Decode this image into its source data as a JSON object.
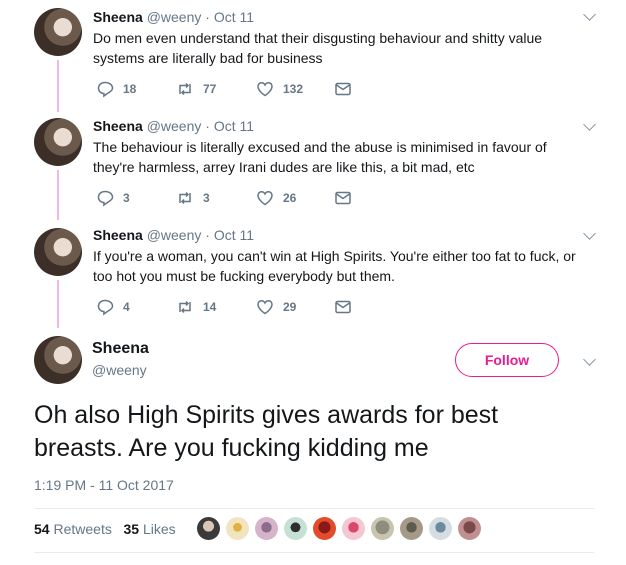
{
  "colors": {
    "accent": "#e81c8f",
    "thread_line": "#f4b8e6",
    "muted": "#657786"
  },
  "replies": [
    {
      "name": "Sheena",
      "handle": "@weeny",
      "date": "Oct 11",
      "lines": [
        "Do men even understand that their disgusting behaviour and shitty value",
        "systems are literally bad for business"
      ],
      "counts": {
        "replies": "18",
        "retweets": "77",
        "likes": "132"
      }
    },
    {
      "name": "Sheena",
      "handle": "@weeny",
      "date": "Oct 11",
      "lines": [
        "The behaviour is literally excused and the abuse is minimised in favour of",
        "they're harmless, arrey Irani dudes are like this, a bit mad, etc"
      ],
      "counts": {
        "replies": "3",
        "retweets": "3",
        "likes": "26"
      }
    },
    {
      "name": "Sheena",
      "handle": "@weeny",
      "date": "Oct 11",
      "lines": [
        "If you're a woman, you can't win at High Spirits. You're either too fat to fuck, or",
        "too hot you must be fucking everybody but them."
      ],
      "counts": {
        "replies": "4",
        "retweets": "14",
        "likes": "29"
      }
    }
  ],
  "main": {
    "name": "Sheena",
    "handle": "@weeny",
    "follow_label": "Follow",
    "text_line1": "Oh also High Spirits gives awards for best",
    "text_line2": "breasts. Are you fucking kidding me",
    "timestamp": "1:19 PM - 11 Oct 2017",
    "retweets_count": "54",
    "retweets_label": "Retweets",
    "likes_count": "35",
    "likes_label": "Likes"
  },
  "icons": {
    "reply": "reply-icon",
    "retweet": "retweet-icon",
    "like": "heart-icon",
    "dm": "envelope-icon",
    "menu": "chevron-down-icon"
  }
}
